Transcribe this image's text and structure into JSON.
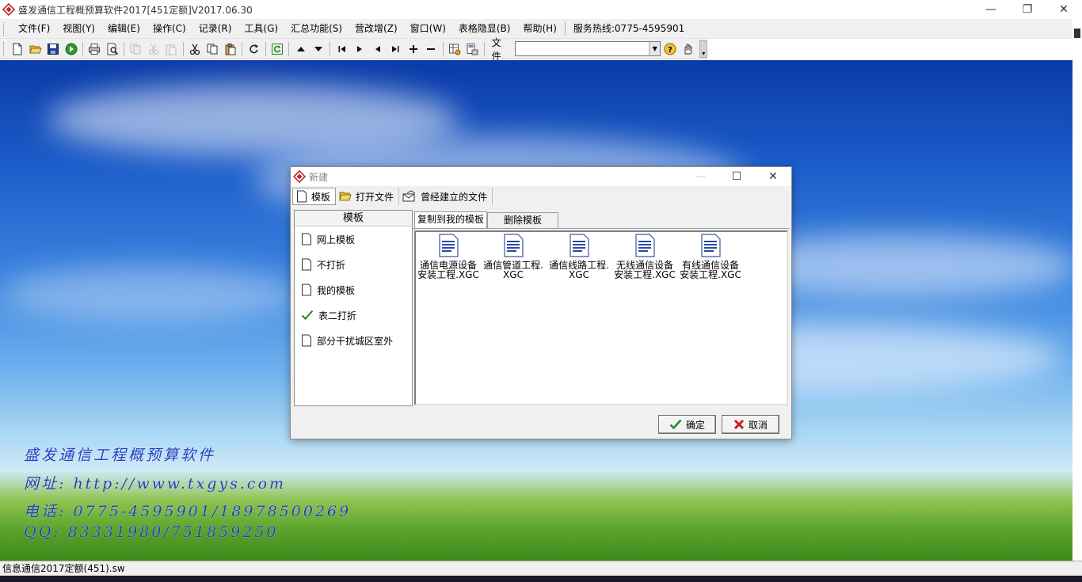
{
  "app": {
    "title": "盛发通信工程概预算软件2017[451定额]V2017.06.30"
  },
  "window_controls": {
    "minimize": "—",
    "restore": "❐",
    "close": "✕"
  },
  "menu": [
    {
      "label": "文件(F)"
    },
    {
      "label": "视图(Y)"
    },
    {
      "label": "编辑(E)"
    },
    {
      "label": "操作(C)"
    },
    {
      "label": "记录(R)"
    },
    {
      "label": "工具(G)"
    },
    {
      "label": "汇总功能(S)"
    },
    {
      "label": "营改增(Z)"
    },
    {
      "label": "窗口(W)"
    },
    {
      "label": "表格隐显(B)"
    },
    {
      "label": "帮助(H)"
    }
  ],
  "hotline": "服务热线:0775-4595901",
  "toolbar": {
    "file_label": "文件",
    "file_combo_value": ""
  },
  "desktop": {
    "promo_lines": [
      "盛发通信工程概预算软件",
      "网址: http://www.txgys.com",
      "电话: 0775-4595901/18978500269",
      "QQ: 83331980/751859250"
    ]
  },
  "dialog": {
    "title": "新建",
    "tabs": [
      {
        "label": "模板",
        "icon": "document-icon"
      },
      {
        "label": "打开文件",
        "icon": "folder-open-icon"
      },
      {
        "label": "曾经建立的文件",
        "icon": "envelope-icon"
      }
    ],
    "left_header": "模板",
    "left_items": [
      {
        "label": "网上模板",
        "icon": "document-icon"
      },
      {
        "label": "不打折",
        "icon": "document-icon"
      },
      {
        "label": "我的模板",
        "icon": "document-icon"
      },
      {
        "label": "表二打折",
        "icon": "checkmark-icon"
      },
      {
        "label": "部分干扰城区室外",
        "icon": "document-icon"
      }
    ],
    "right_tabs": [
      "复制到我的模板",
      "删除模板"
    ],
    "files": [
      {
        "line1": "通信电源设备",
        "line2": "安装工程.XGC"
      },
      {
        "line1": "通信管道工程.",
        "line2": "XGC"
      },
      {
        "line1": "通信线路工程.",
        "line2": "XGC"
      },
      {
        "line1": "无线通信设备",
        "line2": "安装工程.XGC"
      },
      {
        "line1": "有线通信设备",
        "line2": "安装工程.XGC"
      }
    ],
    "ok_label": "确定",
    "cancel_label": "取消"
  },
  "status": {
    "text": "信息通信2017定额(451).sw"
  }
}
